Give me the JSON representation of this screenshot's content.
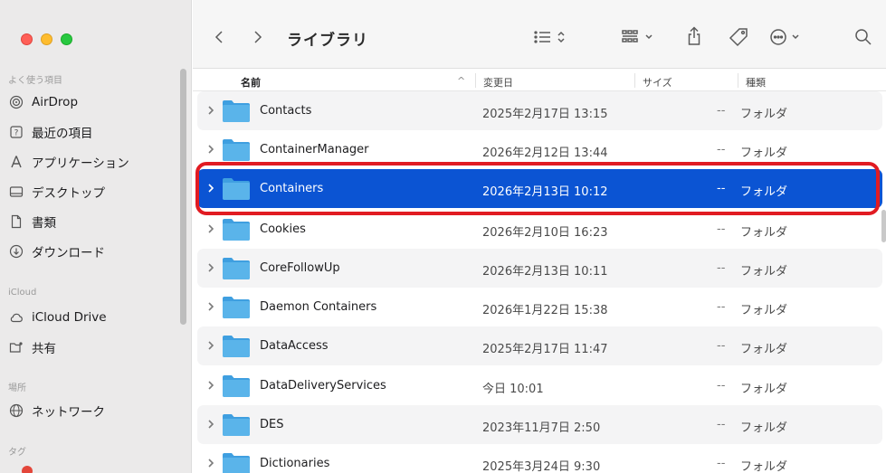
{
  "toolbar": {
    "title": "ライブラリ"
  },
  "sidebar": {
    "sections": {
      "favorites": "よく使う項目",
      "icloud": "iCloud",
      "locations": "場所",
      "tags": "タグ"
    },
    "items": [
      {
        "label": "AirDrop",
        "icon": "airdrop-icon"
      },
      {
        "label": "最近の項目",
        "icon": "recents-icon"
      },
      {
        "label": "アプリケーション",
        "icon": "applications-icon"
      },
      {
        "label": "デスクトップ",
        "icon": "desktop-icon"
      },
      {
        "label": "書類",
        "icon": "document-icon"
      },
      {
        "label": "ダウンロード",
        "icon": "download-icon"
      },
      {
        "label": "iCloud Drive",
        "icon": "cloud-icon"
      },
      {
        "label": "共有",
        "icon": "shared-folder-icon"
      },
      {
        "label": "ネットワーク",
        "icon": "network-globe-icon"
      }
    ]
  },
  "columns": {
    "name": "名前",
    "date": "変更日",
    "size": "サイズ",
    "kind": "種類"
  },
  "rows": [
    {
      "name": "Contacts",
      "date": "2025年2月17日 13:15",
      "size": "--",
      "kind": "フォルダ"
    },
    {
      "name": "ContainerManager",
      "date": "2026年2月12日 13:44",
      "size": "--",
      "kind": "フォルダ"
    },
    {
      "name": "Containers",
      "date": "2026年2月13日 10:12",
      "size": "--",
      "kind": "フォルダ"
    },
    {
      "name": "Cookies",
      "date": "2026年2月10日 16:23",
      "size": "--",
      "kind": "フォルダ"
    },
    {
      "name": "CoreFollowUp",
      "date": "2026年2月13日 10:11",
      "size": "--",
      "kind": "フォルダ"
    },
    {
      "name": "Daemon Containers",
      "date": "2026年1月22日 15:38",
      "size": "--",
      "kind": "フォルダ"
    },
    {
      "name": "DataAccess",
      "date": "2025年2月17日 11:47",
      "size": "--",
      "kind": "フォルダ"
    },
    {
      "name": "DataDeliveryServices",
      "date": "今日 10:01",
      "size": "--",
      "kind": "フォルダ"
    },
    {
      "name": "DES",
      "date": "2023年11月7日 2:50",
      "size": "--",
      "kind": "フォルダ"
    },
    {
      "name": "Dictionaries",
      "date": "2025年3月24日 9:30",
      "size": "--",
      "kind": "フォルダ"
    }
  ],
  "colors": {
    "selection": "#0b54d3",
    "annotation": "#e11b22",
    "folder": "#5ab4ea"
  }
}
